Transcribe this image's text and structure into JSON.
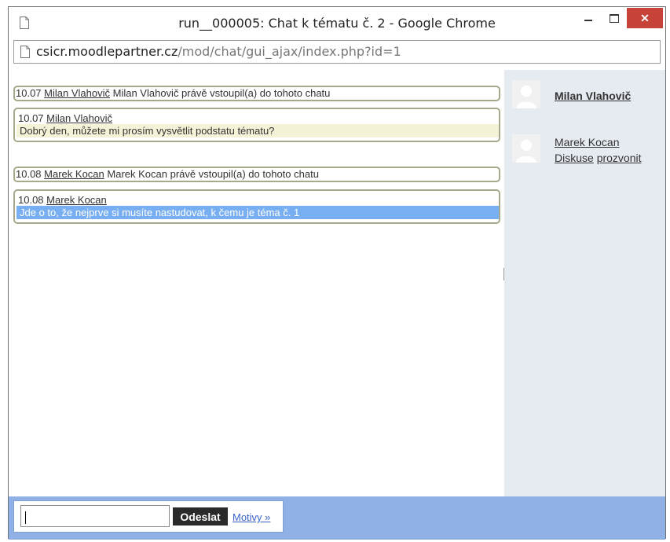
{
  "window": {
    "title": "run__000005: Chat k tématu č. 2 - Google Chrome",
    "close_glyph": "✕"
  },
  "address": {
    "host": "csicr.moodlepartner.cz",
    "path": "/mod/chat/gui_ajax/index.php?id=1"
  },
  "messages": [
    {
      "type": "system",
      "time": "10.07",
      "user": "Milan Vlahovič",
      "text": "Milan Vlahovič právě vstoupil(a) do tohoto chatu"
    },
    {
      "type": "chat",
      "time": "10.07",
      "user": "Milan Vlahovič",
      "text": "Dobrý den, můžete mi prosím vysvětlit podstatu tématu?"
    },
    {
      "type": "system",
      "time": "10.08",
      "user": "Marek Kocan",
      "text": "Marek Kocan právě vstoupil(a) do tohoto chatu"
    },
    {
      "type": "chat",
      "time": "10.08",
      "user": "Marek Kocan",
      "text": "Jde o to, že nejprve si musíte nastudovat, k čemu je téma č. 1"
    }
  ],
  "users": [
    {
      "name": "Milan Vlahovič"
    },
    {
      "name": "Marek Kocan",
      "action_talk": "Diskuse",
      "action_beep": "prozvonit"
    }
  ],
  "input": {
    "value": "",
    "send_label": "Odeslat",
    "themes_label": "Motivy »"
  },
  "icons": {
    "page": "page-icon",
    "minimize": "minimize-icon",
    "maximize": "maximize-icon",
    "close": "close-icon",
    "avatar": "user-avatar-icon"
  }
}
